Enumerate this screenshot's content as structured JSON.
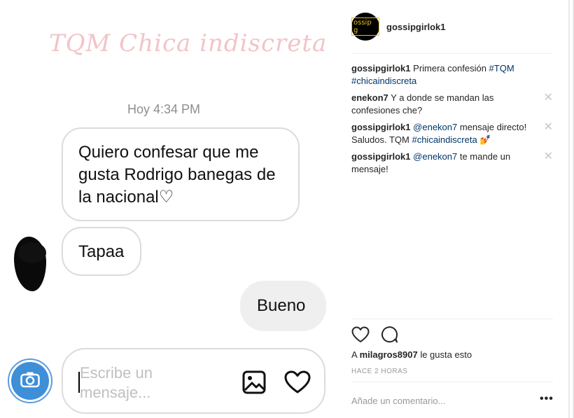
{
  "post_image": {
    "watermark": "TQM Chica indiscreta",
    "timestamp": "Hoy 4:34 PM",
    "messages": [
      {
        "text": "Quiero confesar que me gusta Rodrigo banegas de la nacional♡"
      },
      {
        "text": "Tapaa"
      },
      {
        "text": "Bueno"
      }
    ],
    "composer_placeholder": "Escribe un mensaje..."
  },
  "header": {
    "avatar_text": "ossip g",
    "username": "gossipgirlok1"
  },
  "comments": [
    {
      "user": "gossipgirlok1",
      "parts": [
        {
          "t": "Primera confesión ",
          "link": false
        },
        {
          "t": "#TQM",
          "link": true
        },
        {
          "t": " ",
          "link": false
        },
        {
          "t": "#chicaindiscreta",
          "link": true
        }
      ],
      "deletable": false
    },
    {
      "user": "enekon7",
      "parts": [
        {
          "t": "Y a donde se mandan las confesiones che?",
          "link": false
        }
      ],
      "deletable": true
    },
    {
      "user": "gossipgirlok1",
      "parts": [
        {
          "t": "@enekon7",
          "link": true
        },
        {
          "t": " mensaje directo! Saludos. TQM ",
          "link": false
        },
        {
          "t": "#chicaindiscreta",
          "link": true
        },
        {
          "t": " 💅",
          "link": false
        }
      ],
      "deletable": true
    },
    {
      "user": "gossipgirlok1",
      "parts": [
        {
          "t": "@enekon7",
          "link": true
        },
        {
          "t": " te mande un mensaje!",
          "link": false
        }
      ],
      "deletable": true
    }
  ],
  "delete_glyph": "✕",
  "likes": {
    "prefix": "A",
    "user": "milagros8907",
    "suffix": "le gusta esto"
  },
  "time_ago": "HACE 2 HORAS",
  "add_comment_placeholder": "Añade un comentario...",
  "more_glyph": "•••",
  "icons": {
    "like": "heart-outline-icon",
    "comment": "speech-bubble-icon",
    "camera": "camera-icon",
    "gallery": "image-gallery-icon",
    "composer_like": "heart-icon"
  },
  "colors": {
    "link": "#003569",
    "watermark": "#f2c4c8",
    "camera": "#3e8ed8"
  }
}
